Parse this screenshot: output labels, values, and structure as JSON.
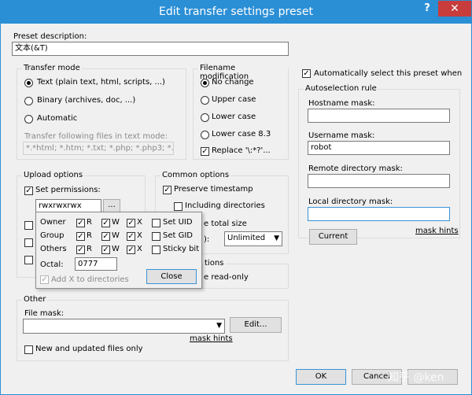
{
  "window": {
    "title": "Edit transfer settings preset",
    "help": "?",
    "close": "✕"
  },
  "preset": {
    "label": "Preset description:",
    "value": "文本(&T)"
  },
  "transfer_mode": {
    "title": "Transfer mode",
    "options": [
      "Text (plain text, html, scripts, ...)",
      "Binary (archives, doc, ...)",
      "Automatic"
    ],
    "selected": 0,
    "text_files_label": "Transfer following files in text mode:",
    "text_files_value": "*.*html; *.htm; *.txt; *.php; *.php3; *.c"
  },
  "filename": {
    "title": "Filename modification",
    "options": [
      "No change",
      "Upper case",
      "Lower case",
      "Lower case 8.3"
    ],
    "selected": 0,
    "replace_label": "Replace '\\:*?'..."
  },
  "autosel": {
    "check_label": "Automatically select this preset when",
    "title": "Autoselection rule",
    "hostname_label": "Hostname mask:",
    "hostname_value": "",
    "username_label": "Username mask:",
    "username_value": "robot",
    "remote_label": "Remote directory mask:",
    "remote_value": "",
    "local_label": "Local directory mask:",
    "local_value": "",
    "current_button": "Current",
    "mask_hints": "mask hints"
  },
  "upload": {
    "title": "Upload options",
    "set_permissions": "Set permissions:",
    "perm_value": "rwxrwxrwx",
    "browse": "..."
  },
  "common": {
    "title": "Common options",
    "preserve": "Preserve timestamp",
    "include_dirs": "Including directories",
    "total_size": "e total size",
    "speed": "Unlimited",
    "speed_prefix": "):",
    "tions": "tions",
    "readonly": "e read-only"
  },
  "perm_popup": {
    "rows": [
      "Owner",
      "Group",
      "Others"
    ],
    "col_r": "R",
    "col_w": "W",
    "col_x": "X",
    "special": [
      "Set UID",
      "Set GID",
      "Sticky bit"
    ],
    "octal_label": "Octal:",
    "octal_value": "0777",
    "add_x": "Add X to directories",
    "close_button": "Close"
  },
  "other": {
    "title": "Other",
    "file_mask_label": "File mask:",
    "file_mask_value": "",
    "edit_button": "Edit...",
    "mask_hints": "mask hints",
    "new_updated": "New and updated files only"
  },
  "footer": {
    "ok": "OK",
    "cancel": "Cancel"
  },
  "watermark": "知乎 @ken",
  "colors": {
    "title_bar": "#2b8fd6",
    "close_button": "#c83c3c",
    "face": "#f0f0f0"
  }
}
